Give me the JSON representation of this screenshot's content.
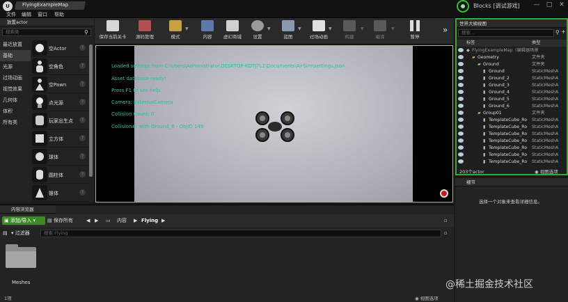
{
  "window": {
    "doc_tab": "FlyingExampleMap",
    "title": "Blocks [调试游戏]",
    "menus": [
      "文件",
      "编辑",
      "窗口",
      "帮助"
    ],
    "controls": [
      "—",
      "□",
      "✕"
    ]
  },
  "place_actors": {
    "tab": "放置actor",
    "search_placeholder": "搜索类",
    "categories": [
      "最近放置",
      "基础",
      "光源",
      "过场动画",
      "视觉效果",
      "几何体",
      "体积",
      "所有类"
    ],
    "active_category": 1,
    "items": [
      "空Actor",
      "空角色",
      "空Pawn",
      "点光源",
      "玩家出生点",
      "立方体",
      "球体",
      "圆柱体",
      "锥体"
    ]
  },
  "toolbar": {
    "buttons": [
      "保存当前关卡",
      "源码管理",
      "模式",
      "内容",
      "虚幻商城",
      "设置",
      "蓝图",
      "过场动画",
      "构建",
      "编译",
      "暂停"
    ],
    "more": "»"
  },
  "viewport": {
    "log": [
      "Loaded settings from C:\\Users\\Administrator.DESKTOP-KDTJ7L1\\Documents\\AirSim\\settings.json",
      "Asset database ready!",
      "Press F1 to see help",
      "Camera: ExternalCamera",
      "Collision Count: 0",
      "Collision#: with Ground_6 - ObjID 148"
    ]
  },
  "outliner": {
    "tab": "世界大纲视图",
    "search_placeholder": "搜索...",
    "col_label": "标签",
    "col_type": "类型",
    "rows": [
      {
        "label": "FlyingExampleMap（编辑器场景",
        "type": "",
        "indent": 0
      },
      {
        "label": "Geometry",
        "type": "文件夹",
        "indent": 1
      },
      {
        "label": "Ground",
        "type": "文件夹",
        "indent": 2
      },
      {
        "label": "Ground",
        "type": "StaticMeshA",
        "indent": 3
      },
      {
        "label": "Ground_2",
        "type": "StaticMeshA",
        "indent": 3
      },
      {
        "label": "Ground_3",
        "type": "StaticMeshA",
        "indent": 3
      },
      {
        "label": "Ground_4",
        "type": "StaticMeshA",
        "indent": 3
      },
      {
        "label": "Ground_5",
        "type": "StaticMeshA",
        "indent": 3
      },
      {
        "label": "Ground_6",
        "type": "StaticMeshA",
        "indent": 3
      },
      {
        "label": "Group01",
        "type": "文件夹",
        "indent": 2
      },
      {
        "label": "TemplateCube_Ro",
        "type": "StaticMeshA",
        "indent": 3
      },
      {
        "label": "TemplateCube_Ro",
        "type": "StaticMeshA",
        "indent": 3
      },
      {
        "label": "TemplateCube_Ro",
        "type": "StaticMeshA",
        "indent": 3
      },
      {
        "label": "TemplateCube_Ro",
        "type": "StaticMeshA",
        "indent": 3
      },
      {
        "label": "TemplateCube_Ro",
        "type": "StaticMeshA",
        "indent": 3
      },
      {
        "label": "TemplateCube_Ro",
        "type": "StaticMeshA",
        "indent": 3
      },
      {
        "label": "TemplateCube_Ro",
        "type": "StaticMeshA",
        "indent": 3
      }
    ],
    "count": "203个actor",
    "view_options": "视图选项"
  },
  "details": {
    "tab": "细节",
    "hint": "选择一个对象来查看详细信息。"
  },
  "content_browser": {
    "tab": "内容浏览器",
    "add_import": "添加/导入",
    "save_all": "保存所有",
    "crumb_root": "内容",
    "crumb_current": "Flying",
    "filters": "过滤器",
    "search_placeholder": "搜索 Flying",
    "folder_name": "Meshes",
    "item_count": "1项",
    "view_options": "视图选项"
  },
  "watermark": "@稀土掘金技术社区"
}
